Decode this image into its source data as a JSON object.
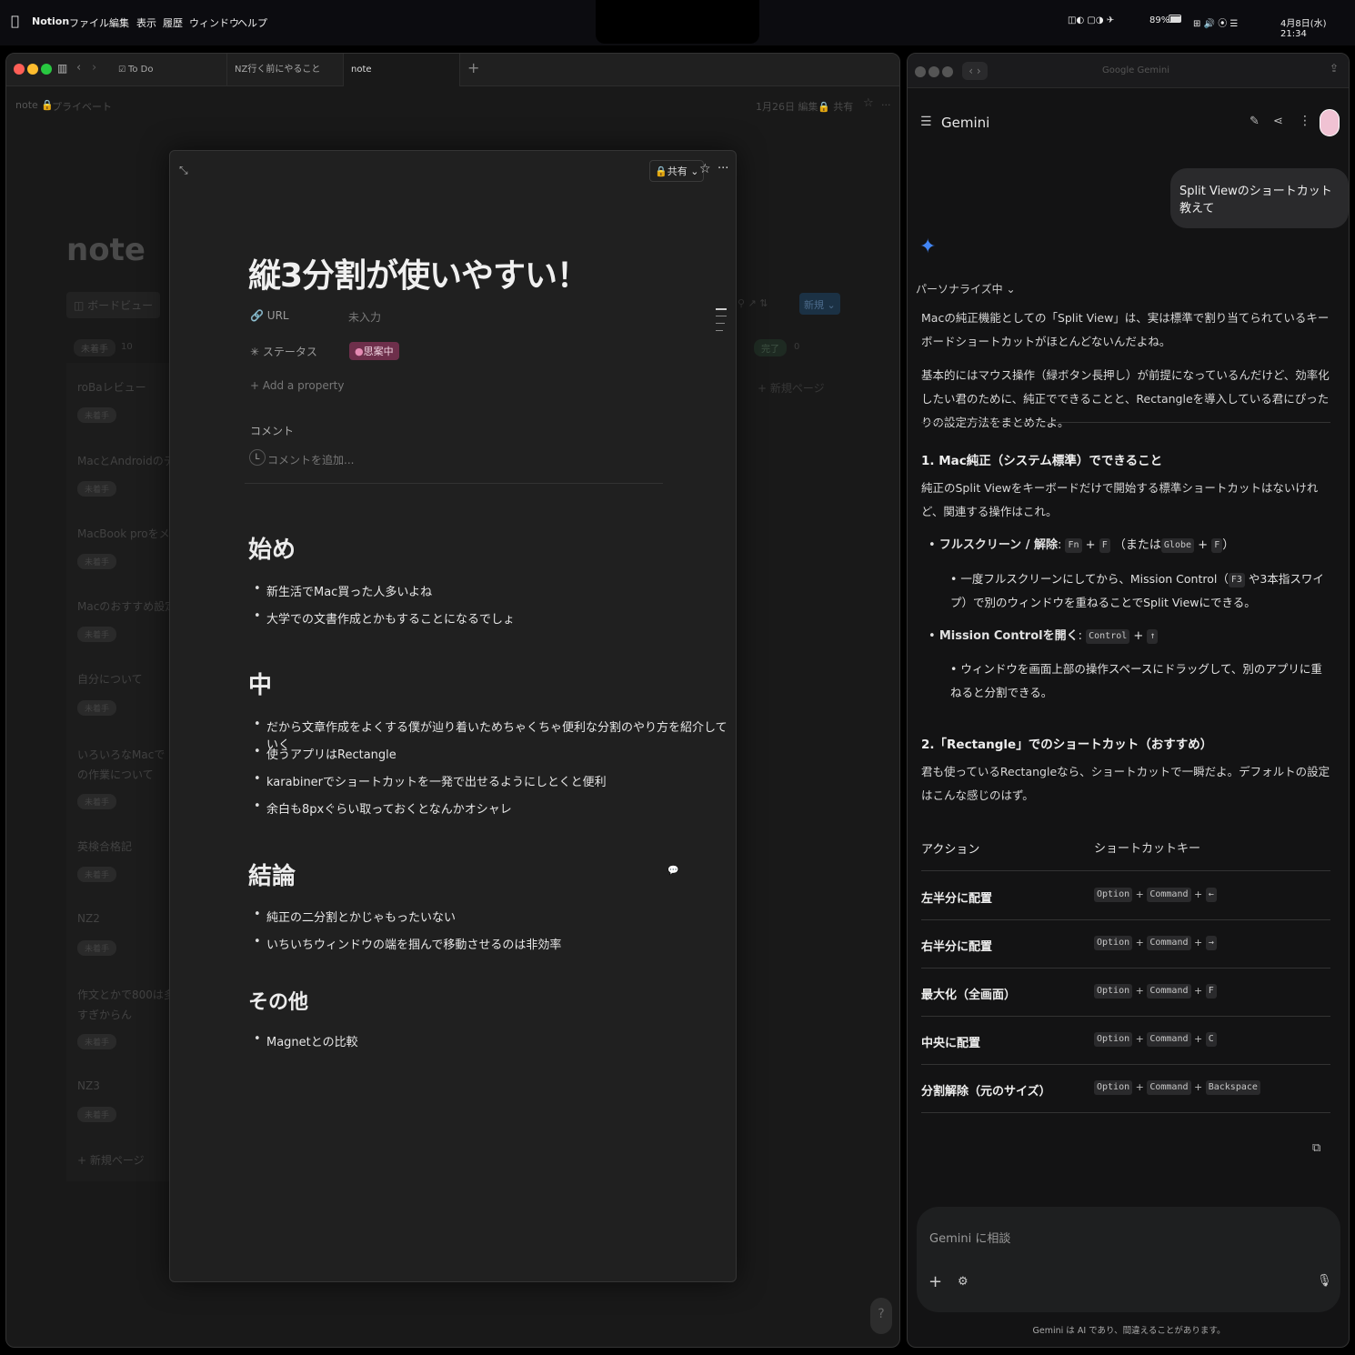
{
  "menubar": {
    "app": "Notion",
    "items": [
      "ファイル",
      "編集",
      "表示",
      "履歴",
      "ウィンドウ",
      "ヘルプ"
    ],
    "battery": "89%",
    "datetime": "4月8日(水) 21:34"
  },
  "notion": {
    "tabs": [
      {
        "label": "To Do"
      },
      {
        "label": "NZ行く前にやること"
      },
      {
        "label": "note"
      }
    ],
    "breadcrumb": {
      "root": "note",
      "sub": "プライベート"
    },
    "header_right": {
      "edited": "1月26日 編集",
      "share": "共有"
    },
    "page_title": "note",
    "view_tab": "ボードビュー",
    "new_button": "新規",
    "columns": {
      "todo": {
        "label": "未着手",
        "count": "10"
      },
      "done": {
        "label": "完了",
        "count": "0"
      },
      "new_page": "新規ページ"
    },
    "cards": [
      {
        "title": "roBaレビュー",
        "tag": "未着手"
      },
      {
        "title": "MacとAndroidのデータ",
        "tag": "未着手"
      },
      {
        "title": "MacBook proをメイン",
        "tag": "未着手"
      },
      {
        "title": "Macのおすすめ設定",
        "tag": "未着手"
      },
      {
        "title": "自分について",
        "tag": "未着手"
      },
      {
        "title": "いろいろなMacでの作業について",
        "tag": "未着手"
      },
      {
        "title": "英検合格記",
        "tag": "未着手"
      },
      {
        "title": "NZ2",
        "tag": "未着手"
      },
      {
        "title": "作文とかで800は多すぎからん",
        "tag": "未着手"
      },
      {
        "title": "NZ3",
        "tag": "未着手"
      }
    ],
    "board_new_page": "新規ページ"
  },
  "modal": {
    "share": "共有",
    "title": "縦3分割が使いやすい！",
    "props": {
      "url_label": "URL",
      "url_value": "未入力",
      "status_label": "ステータス",
      "status_value": "思案中",
      "add": "Add a property"
    },
    "comment_label": "コメント",
    "comment_placeholder": "コメントを追加...",
    "avatar_letter": "L",
    "sections": [
      {
        "heading": "始め",
        "items": [
          "新生活でMac買った人多いよね",
          "大学での文書作成とかもすることになるでしょ"
        ]
      },
      {
        "heading": "中",
        "items": [
          "だから文章作成をよくする僕が辿り着いためちゃくちゃ便利な分割のやり方を紹介していく",
          "使うアプリはRectangle",
          "karabinerでショートカットを一発で出せるようにしとくと便利",
          "余白も8pxぐらい取っておくとなんかオシャレ"
        ]
      },
      {
        "heading": "結論",
        "items": [
          "純正の二分割とかじゃもったいない",
          "いちいちウィンドウの端を掴んで移動させるのは非効率"
        ]
      },
      {
        "heading": "その他",
        "items": [
          "Magnetとの比較"
        ]
      }
    ]
  },
  "gemini": {
    "window_title": "Google Gemini",
    "app_name": "Gemini",
    "user_message": "Split Viewのショートカット教えて",
    "personalize": "パーソナライズ中",
    "p1": "Macの純正機能としての「Split View」は、実は標準で割り当てられているキーボードショートカットがほとんどないんだよね。",
    "p2": "基本的にはマウス操作（緑ボタン長押し）が前提になっているんだけど、効率化したい君のために、純正でできることと、Rectangleを導入している君にぴったりの設定方法をまとめたよ。",
    "h1": "1. Mac純正（システム標準）でできること",
    "p3": "純正のSplit Viewをキーボードだけで開始する標準ショートカットはないけれど、関連する操作はこれ。",
    "b1_label": "フルスクリーン / 解除",
    "b1_text1": "（または",
    "b1_text2": "）",
    "b1_sub": "一度フルスクリーンにしてから、Mission Control（",
    "b1_sub2": "や3本指スワイプ）で別のウィンドウを重ねることでSplit Viewにできる。",
    "b2_label": "Mission Controlを開く",
    "b2_sub": "ウィンドウを画面上部の操作スペースにドラッグして、別のアプリに重ねると分割できる。",
    "h2": "2.「Rectangle」でのショートカット（おすすめ）",
    "p4": "君も使っているRectangleなら、ショートカットで一瞬だよ。デフォルトの設定はこんな感じのはず。",
    "table_headers": [
      "アクション",
      "ショートカットキー"
    ],
    "table_rows": [
      {
        "action": "左半分に配置",
        "keys": [
          "Option",
          "Command",
          "←"
        ]
      },
      {
        "action": "右半分に配置",
        "keys": [
          "Option",
          "Command",
          "→"
        ]
      },
      {
        "action": "最大化（全画面）",
        "keys": [
          "Option",
          "Command",
          "F"
        ]
      },
      {
        "action": "中央に配置",
        "keys": [
          "Option",
          "Command",
          "C"
        ]
      },
      {
        "action": "分割解除（元のサイズ）",
        "keys": [
          "Option",
          "Command",
          "Backspace"
        ]
      }
    ],
    "keys": {
      "fn": "Fn",
      "f": "F",
      "globe": "Globe",
      "f3": "F3",
      "control": "Control",
      "up": "↑",
      "plus": "+"
    },
    "input_placeholder": "Gemini に相談",
    "disclaimer": "Gemini は AI であり、間違えることがあります。"
  },
  "colors": {
    "status_bg": "#6e2f4b",
    "accent_blue": "#4285f4",
    "modal_bg": "#202020"
  }
}
